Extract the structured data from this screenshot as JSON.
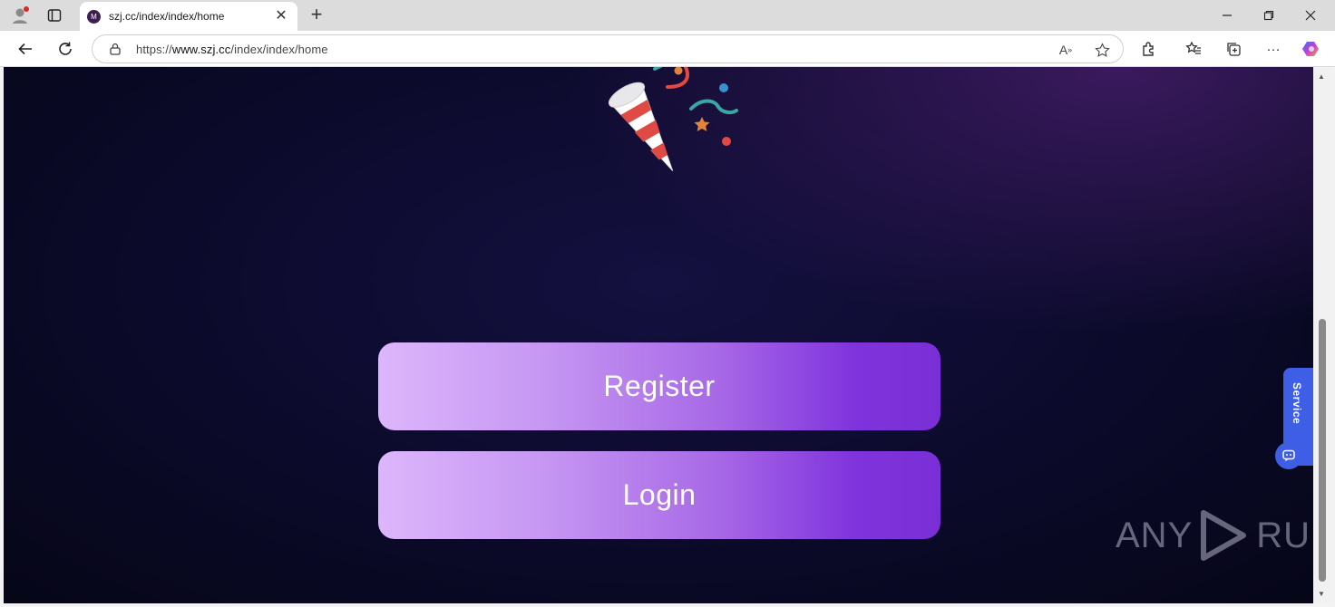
{
  "browser": {
    "tab_title": "szj.cc/index/index/home",
    "tab_favicon_letter": "M",
    "url_prefix": "https://",
    "url_domain": "www.szj.cc",
    "url_path": "/index/index/home"
  },
  "page": {
    "register_label": "Register",
    "login_label": "Login",
    "service_label": "Service",
    "watermark_left": "ANY",
    "watermark_right": "RUN"
  },
  "colors": {
    "button_gradient_start": "#dcb6fb",
    "button_gradient_end": "#7a2fd6",
    "service_blue": "#3f5ee6",
    "background_dark": "#0b0a2a"
  },
  "icons": {
    "party_popper": "party-popper-icon",
    "service_chat": "chat-icon"
  }
}
